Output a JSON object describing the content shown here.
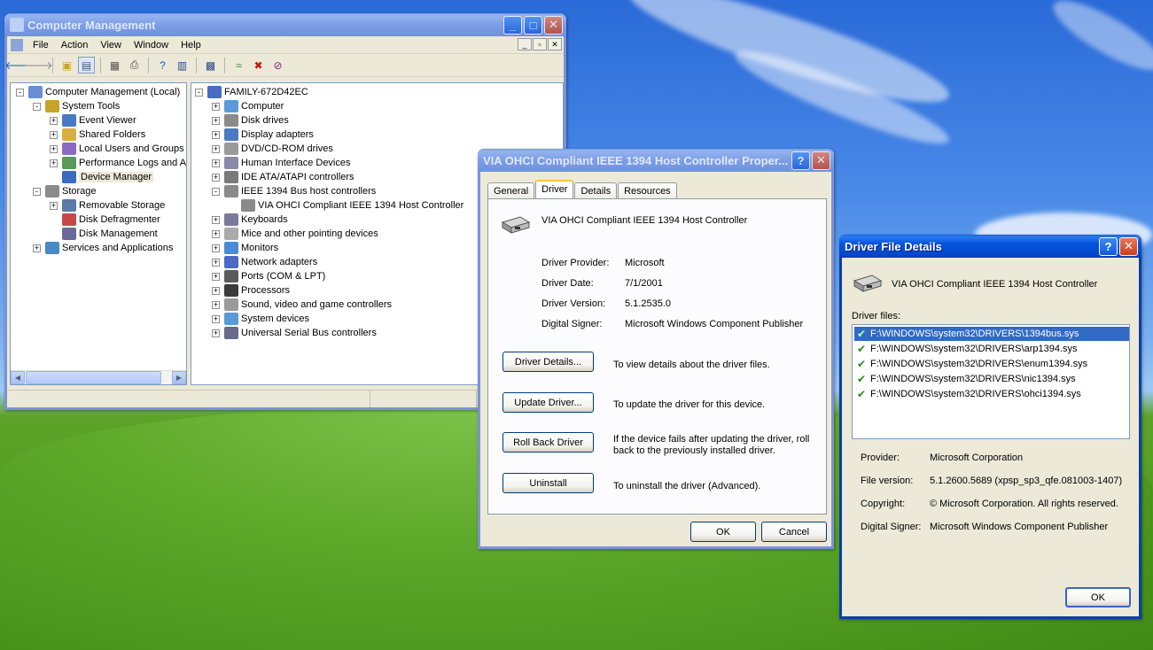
{
  "colors": {
    "xp_blue": "#0a3ea8",
    "selection": "#316ac5",
    "face": "#ece9d8"
  },
  "computer_management": {
    "title": "Computer Management",
    "menu": [
      "File",
      "Action",
      "View",
      "Window",
      "Help"
    ],
    "toolbar_icons": [
      "back-arrow-icon",
      "forward-arrow-icon",
      "up-folder-icon",
      "show-hide-tree-icon",
      "properties-icon",
      "print-icon",
      "help-icon",
      "console-icon",
      "scan-hardware-icon",
      "remove-icon",
      "uninstall-icon",
      "disable-device-icon"
    ],
    "left_tree": [
      {
        "label": "Computer Management (Local)",
        "icon": "computer-management-icon"
      },
      {
        "label": "System Tools",
        "icon": "system-tools-icon"
      },
      {
        "label": "Event Viewer",
        "icon": "event-viewer-icon"
      },
      {
        "label": "Shared Folders",
        "icon": "shared-folders-icon"
      },
      {
        "label": "Local Users and Groups",
        "icon": "users-groups-icon"
      },
      {
        "label": "Performance Logs and Alerts",
        "icon": "performance-logs-icon"
      },
      {
        "label": "Device Manager",
        "icon": "device-manager-icon",
        "selected": true
      },
      {
        "label": "Storage",
        "icon": "storage-icon"
      },
      {
        "label": "Removable Storage",
        "icon": "removable-storage-icon"
      },
      {
        "label": "Disk Defragmenter",
        "icon": "disk-defragmenter-icon"
      },
      {
        "label": "Disk Management",
        "icon": "disk-management-icon"
      },
      {
        "label": "Services and Applications",
        "icon": "services-icon"
      }
    ],
    "right_tree": [
      {
        "label": "FAMILY-672D42EC",
        "icon": "computer-icon"
      },
      {
        "label": "Computer",
        "icon": "computer-icon"
      },
      {
        "label": "Disk drives",
        "icon": "disk-drive-icon"
      },
      {
        "label": "Display adapters",
        "icon": "display-adapter-icon"
      },
      {
        "label": "DVD/CD-ROM drives",
        "icon": "cdrom-icon"
      },
      {
        "label": "Human Interface Devices",
        "icon": "hid-icon"
      },
      {
        "label": "IDE ATA/ATAPI controllers",
        "icon": "ide-controller-icon"
      },
      {
        "label": "IEEE 1394 Bus host controllers",
        "icon": "ieee1394-icon"
      },
      {
        "label": "VIA OHCI Compliant IEEE 1394 Host Controller",
        "icon": "ieee1394-icon"
      },
      {
        "label": "Keyboards",
        "icon": "keyboard-icon"
      },
      {
        "label": "Mice and other pointing devices",
        "icon": "mouse-icon"
      },
      {
        "label": "Monitors",
        "icon": "monitor-icon"
      },
      {
        "label": "Network adapters",
        "icon": "network-adapter-icon"
      },
      {
        "label": "Ports (COM & LPT)",
        "icon": "port-icon"
      },
      {
        "label": "Processors",
        "icon": "processor-icon"
      },
      {
        "label": "Sound, video and game controllers",
        "icon": "sound-icon"
      },
      {
        "label": "System devices",
        "icon": "system-device-icon"
      },
      {
        "label": "Universal Serial Bus controllers",
        "icon": "usb-icon"
      }
    ]
  },
  "properties": {
    "title": "VIA OHCI Compliant IEEE 1394 Host Controller Proper...",
    "tabs": [
      "General",
      "Driver",
      "Details",
      "Resources"
    ],
    "active_tab": "Driver",
    "device_name": "VIA OHCI Compliant IEEE 1394 Host Controller",
    "fields": [
      {
        "label": "Driver Provider:",
        "value": "Microsoft"
      },
      {
        "label": "Driver Date:",
        "value": "7/1/2001"
      },
      {
        "label": "Driver Version:",
        "value": "5.1.2535.0"
      },
      {
        "label": "Digital Signer:",
        "value": "Microsoft Windows Component Publisher"
      }
    ],
    "actions": [
      {
        "button": "Driver Details...",
        "desc": "To view details about the driver files."
      },
      {
        "button": "Update Driver...",
        "desc": "To update the driver for this device."
      },
      {
        "button": "Roll Back Driver",
        "desc": "If the device fails after updating the driver, roll back to the previously installed driver."
      },
      {
        "button": "Uninstall",
        "desc": "To uninstall the driver (Advanced)."
      }
    ],
    "ok": "OK",
    "cancel": "Cancel"
  },
  "driver_details": {
    "title": "Driver File Details",
    "device_name": "VIA OHCI Compliant IEEE 1394 Host Controller",
    "files_label": "Driver files:",
    "files": [
      "F:\\WINDOWS\\system32\\DRIVERS\\1394bus.sys",
      "F:\\WINDOWS\\system32\\DRIVERS\\arp1394.sys",
      "F:\\WINDOWS\\system32\\DRIVERS\\enum1394.sys",
      "F:\\WINDOWS\\system32\\DRIVERS\\nic1394.sys",
      "F:\\WINDOWS\\system32\\DRIVERS\\ohci1394.sys"
    ],
    "selected_file_index": 0,
    "info": [
      {
        "label": "Provider:",
        "value": "Microsoft Corporation"
      },
      {
        "label": "File version:",
        "value": "5.1.2600.5689 (xpsp_sp3_qfe.081003-1407)"
      },
      {
        "label": "Copyright:",
        "value": "© Microsoft Corporation. All rights reserved."
      },
      {
        "label": "Digital Signer:",
        "value": "Microsoft Windows Component Publisher"
      }
    ],
    "ok": "OK"
  }
}
